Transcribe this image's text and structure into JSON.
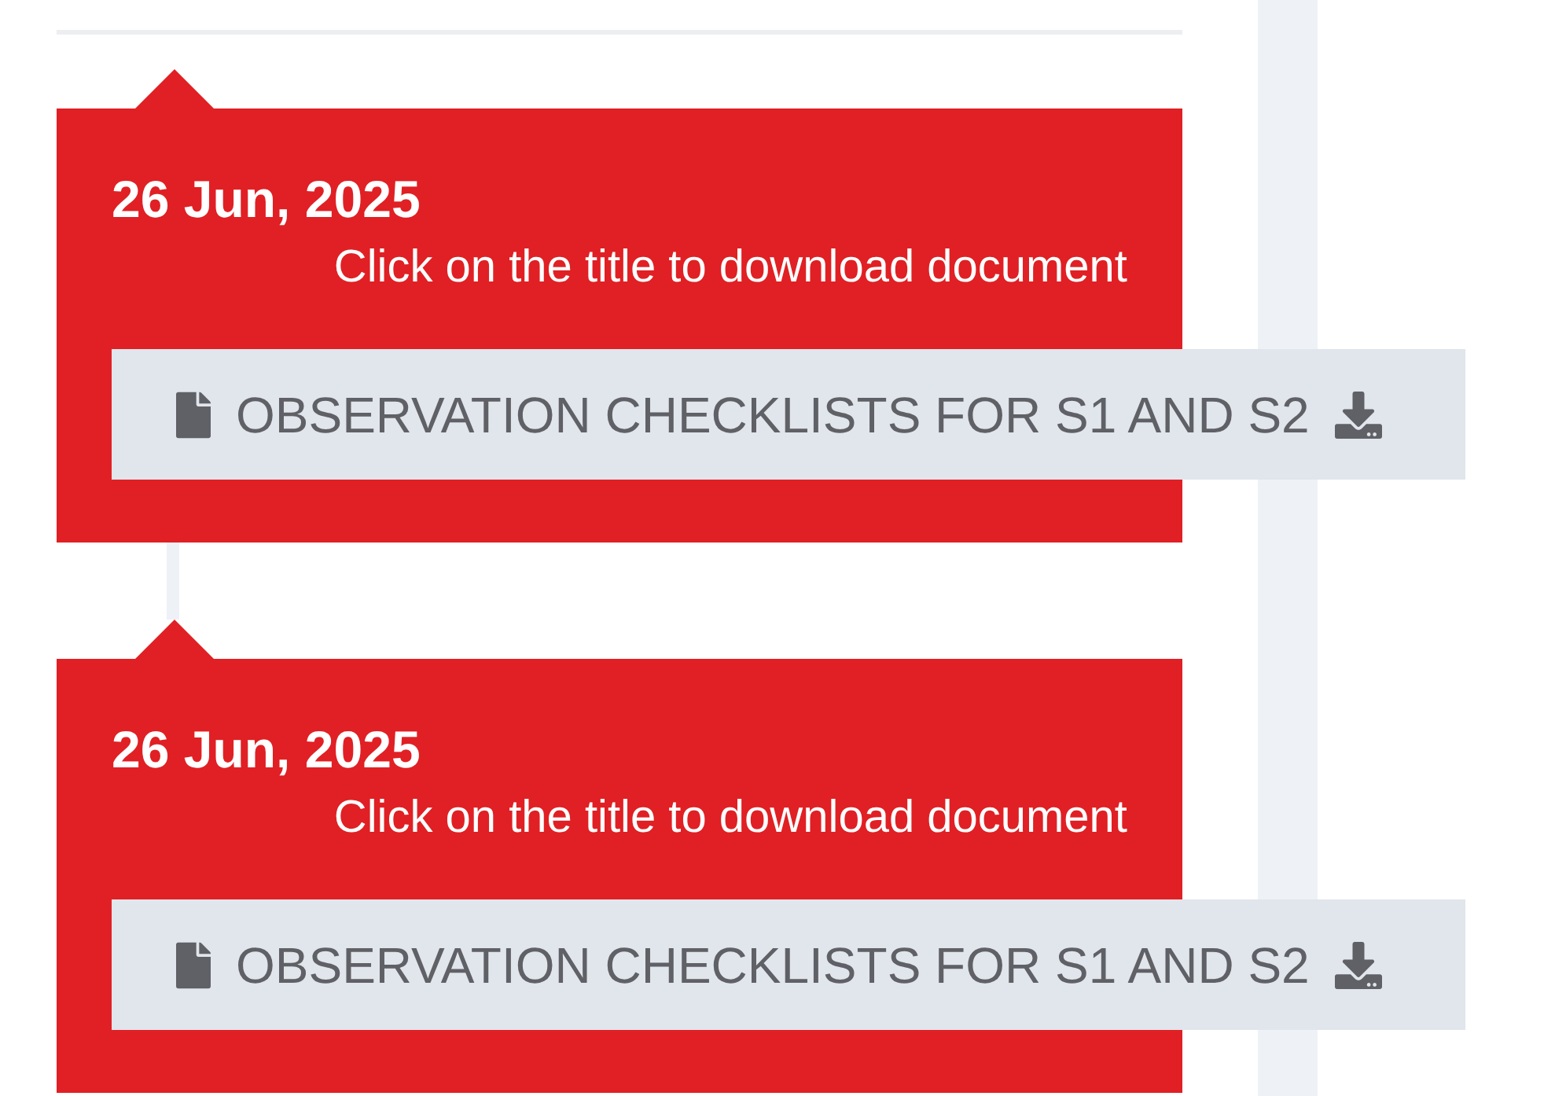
{
  "entries": [
    {
      "date": "26 Jun, 2025",
      "hint": "Click on the title to download document",
      "document": {
        "title": "OBSERVATION CHECKLISTS FOR S1 AND S2"
      }
    },
    {
      "date": "26 Jun, 2025",
      "hint": "Click on the title to download document",
      "document": {
        "title": "OBSERVATION CHECKLISTS FOR S1 AND S2"
      }
    }
  ]
}
